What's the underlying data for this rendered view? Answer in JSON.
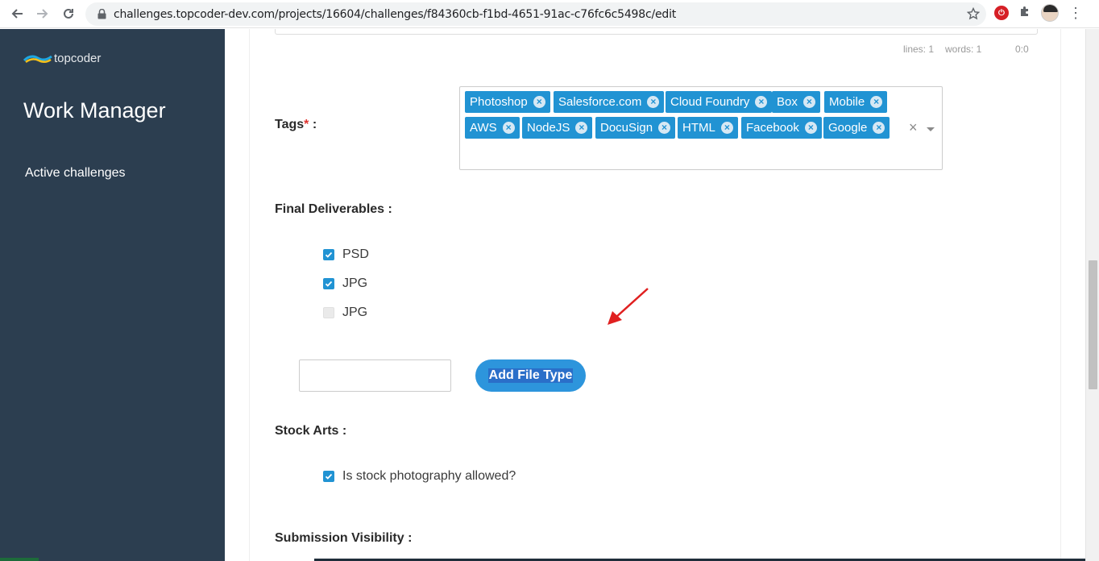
{
  "browser": {
    "url": "challenges.topcoder-dev.com/projects/16604/challenges/f84360cb-f1bd-4651-91ac-c76fc6c5498c/edit"
  },
  "sidebar": {
    "logo_text": "topcoder",
    "app_title": "Work Manager",
    "nav_items": [
      {
        "label": "Active challenges"
      }
    ]
  },
  "editor_stats": {
    "lines": "lines: 1",
    "words": "words: 1",
    "cursor": "0:0"
  },
  "tags": {
    "label": "Tags",
    "required_mark": "*",
    "label_suffix": " :",
    "items": [
      "Photoshop",
      "Salesforce.com",
      "Cloud Foundry",
      "Box",
      "Mobile",
      "AWS",
      "NodeJS",
      "DocuSign",
      "HTML",
      "Facebook",
      "Google"
    ],
    "remove_glyph": "×",
    "clear_glyph": "×"
  },
  "final_deliverables": {
    "label": "Final Deliverables :",
    "options": [
      {
        "label": "PSD",
        "checked": true
      },
      {
        "label": "JPG",
        "checked": true
      },
      {
        "label": "JPG",
        "checked": false
      }
    ],
    "add_file_type_label": "Add File Type",
    "file_type_input_value": ""
  },
  "stock_arts": {
    "label": "Stock Arts :",
    "option": {
      "label": "Is stock photography allowed?",
      "checked": true
    }
  },
  "submission_visibility": {
    "label": "Submission Visibility :"
  },
  "colors": {
    "sidebar_bg": "#2c3e50",
    "accent": "#2193d3",
    "button": "#2d95dc",
    "annotation_arrow": "#e02020"
  }
}
